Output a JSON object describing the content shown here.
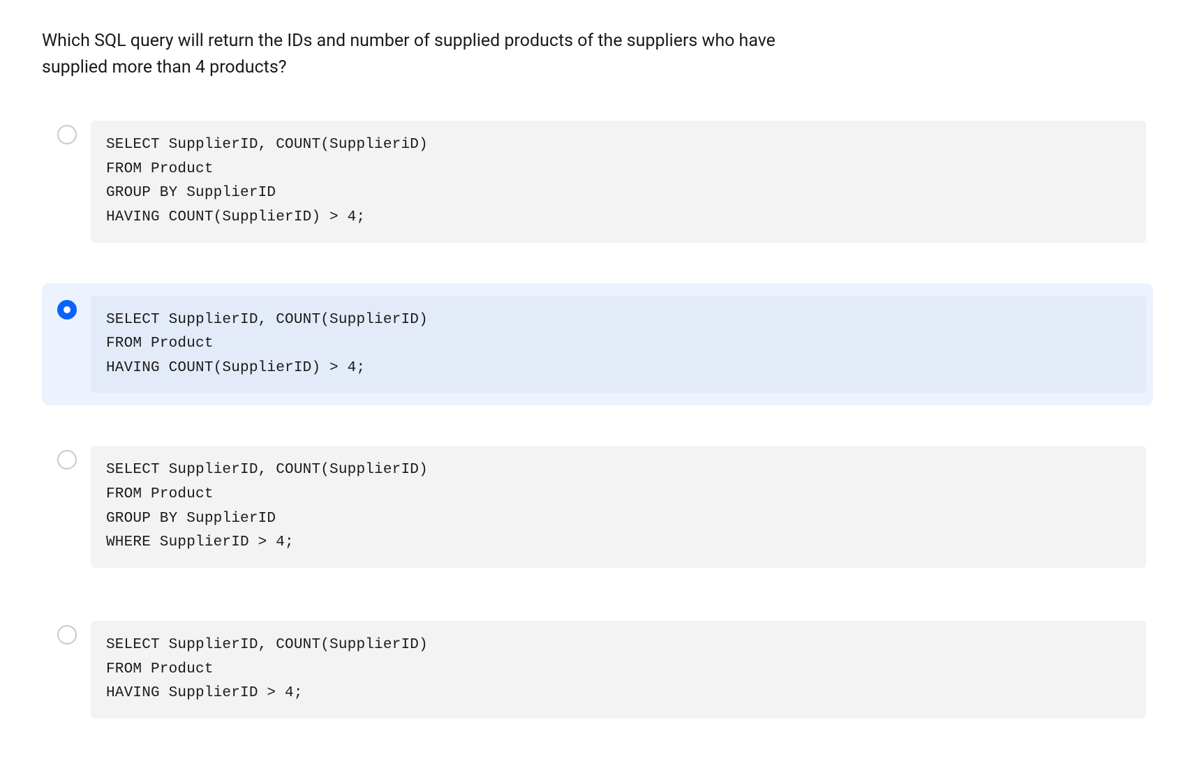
{
  "question": "Which SQL query will return the IDs and number of supplied products of the suppliers who have supplied more than 4 products?",
  "options": [
    {
      "selected": false,
      "code": "SELECT SupplierID, COUNT(SupplieriD)\nFROM Product\nGROUP BY SupplierID\nHAVING COUNT(SupplierID) > 4;"
    },
    {
      "selected": true,
      "code": "SELECT SupplierID, COUNT(SupplierID)\nFROM Product\nHAVING COUNT(SupplierID) > 4;"
    },
    {
      "selected": false,
      "code": "SELECT SupplierID, COUNT(SupplierID)\nFROM Product\nGROUP BY SupplierID\nWHERE SupplierID > 4;"
    },
    {
      "selected": false,
      "code": "SELECT SupplierID, COUNT(SupplierID)\nFROM Product\nHAVING SupplierID > 4;"
    }
  ]
}
